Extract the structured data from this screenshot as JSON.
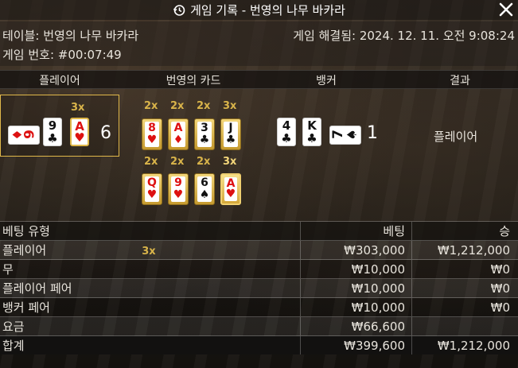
{
  "title": "게임 기록 - 번영의 나무 바카라",
  "icons": {
    "history": "history-clock-icon",
    "close": "close-icon"
  },
  "info": {
    "table": "테이블: 번영의 나무 바카라",
    "settled": "게임 해결됨: 2024. 12. 11. 오전 9:08:24",
    "game_no": "게임 번호: #00:07:49"
  },
  "columns": {
    "player": "플레이어",
    "cards": "번영의 카드",
    "banker": "뱅커",
    "result": "결과"
  },
  "player": {
    "side_card": {
      "rank": "6",
      "suit": "♦",
      "color": "#dd1111"
    },
    "cards": [
      {
        "rank": "9",
        "suit": "♣",
        "color": "#111111"
      },
      {
        "rank": "A",
        "suit": "♥",
        "color": "#dd1111",
        "multiplier": "3x"
      }
    ],
    "score": "6"
  },
  "prosperity_cards": {
    "row1": [
      {
        "rank": "8",
        "suit": "♥",
        "multiplier": "2x",
        "color": "#dd1111"
      },
      {
        "rank": "A",
        "suit": "♦",
        "multiplier": "2x",
        "color": "#dd1111"
      },
      {
        "rank": "3",
        "suit": "♣",
        "multiplier": "2x",
        "color": "#111111"
      },
      {
        "rank": "J",
        "suit": "♣",
        "multiplier": "3x",
        "color": "#111111"
      }
    ],
    "row2": [
      {
        "rank": "Q",
        "suit": "♥",
        "multiplier": "2x",
        "color": "#dd1111"
      },
      {
        "rank": "9",
        "suit": "♥",
        "multiplier": "2x",
        "color": "#dd1111"
      },
      {
        "rank": "6",
        "suit": "♠",
        "multiplier": "2x",
        "color": "#111111"
      },
      {
        "rank": "A",
        "suit": "♥",
        "multiplier": "3x",
        "color": "#dd1111",
        "selected": true
      }
    ]
  },
  "banker": {
    "cards": [
      {
        "rank": "4",
        "suit": "♣",
        "color": "#111111"
      },
      {
        "rank": "K",
        "suit": "♣",
        "color": "#111111"
      }
    ],
    "side_card": {
      "rank": "7",
      "suit": "♠",
      "color": "#111111"
    },
    "score": "1"
  },
  "result": "플레이어",
  "bets": {
    "headers": {
      "type": "베팅 유형",
      "bet": "베팅",
      "win": "승"
    },
    "rows": [
      {
        "type": "플레이어",
        "multiplier": "3x",
        "bet": "₩303,000",
        "win": "₩1,212,000"
      },
      {
        "type": "무",
        "multiplier": "",
        "bet": "₩10,000",
        "win": "₩0"
      },
      {
        "type": "플레이어 페어",
        "multiplier": "",
        "bet": "₩10,000",
        "win": "₩0"
      },
      {
        "type": "뱅커 페어",
        "multiplier": "",
        "bet": "₩10,000",
        "win": "₩0"
      },
      {
        "type": "요금",
        "multiplier": "",
        "bet": "₩66,600",
        "win": ""
      }
    ],
    "total": {
      "type": "합계",
      "bet": "₩399,600",
      "win": "₩1,212,000"
    }
  },
  "colors": {
    "accent_gold": "#d9b44a",
    "red_suit": "#dd1111"
  }
}
